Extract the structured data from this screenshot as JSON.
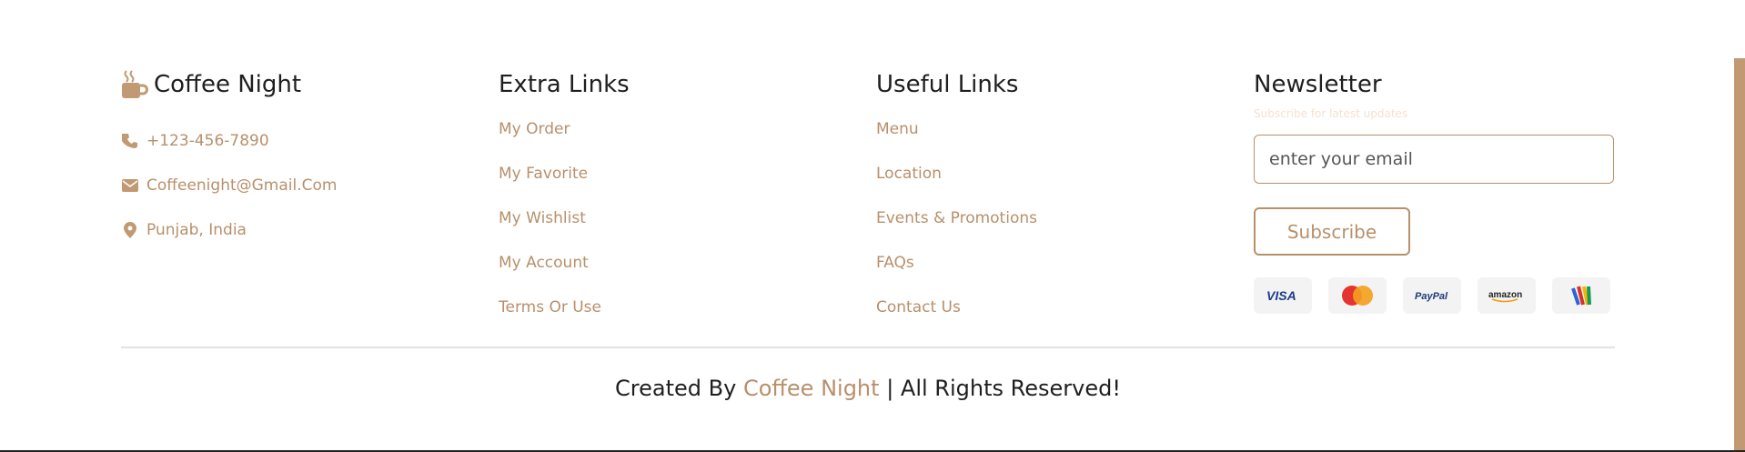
{
  "colors": {
    "accent": "#b8906a",
    "text": "#1f1f1f",
    "strip": "#c19a73"
  },
  "brand": {
    "title": "Coffee Night",
    "icon": "coffee-icon"
  },
  "contact": [
    {
      "icon": "phone-icon",
      "text": "+123-456-7890"
    },
    {
      "icon": "envelope-icon",
      "text": "Coffeenight@Gmail.Com"
    },
    {
      "icon": "map-pin-icon",
      "text": "Punjab, India"
    }
  ],
  "extra_links": {
    "title": "Extra Links",
    "items": [
      "My Order",
      "My Favorite",
      "My Wishlist",
      "My Account",
      "Terms Or Use"
    ]
  },
  "useful_links": {
    "title": "Useful Links",
    "items": [
      "Menu",
      "Location",
      "Events & Promotions",
      "FAQs",
      "Contact Us"
    ]
  },
  "newsletter": {
    "title": "Newsletter",
    "subtitle": "Subscribe for latest updates",
    "placeholder": "enter your email",
    "button": "Subscribe",
    "payments": [
      "visa-icon",
      "mastercard-icon",
      "paypal-icon",
      "amazon-icon",
      "google-wallet-icon"
    ]
  },
  "credit": {
    "prefix": "Created By ",
    "brand": "Coffee Night",
    "suffix": " | All Rights Reserved!"
  }
}
